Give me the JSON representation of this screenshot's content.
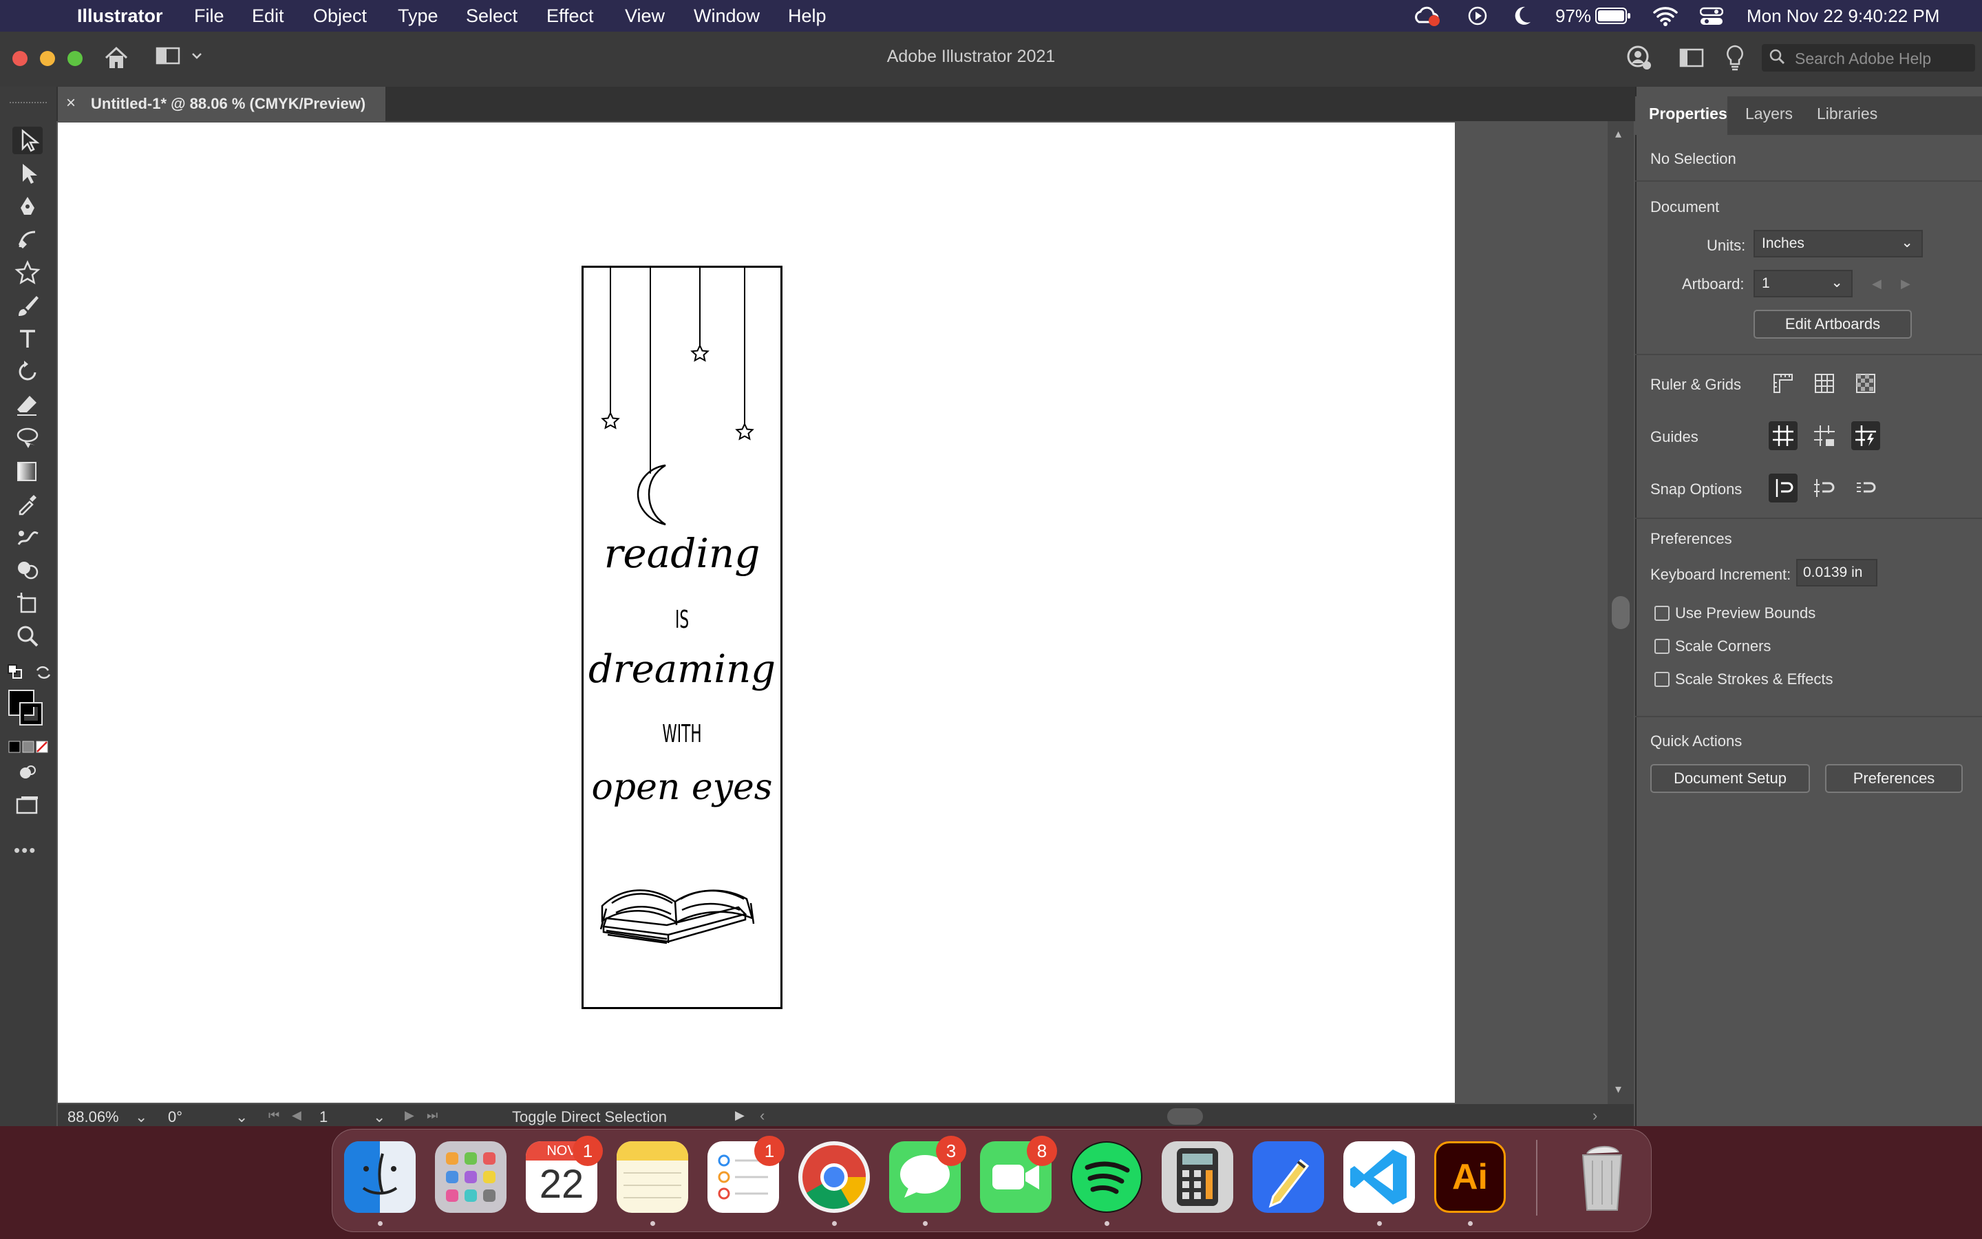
{
  "menubar": {
    "app_name": "Illustrator",
    "items": [
      "File",
      "Edit",
      "Object",
      "Type",
      "Select",
      "Effect",
      "View",
      "Window",
      "Help"
    ],
    "battery": "97%",
    "datetime": "Mon Nov 22  9:40:22 PM"
  },
  "window": {
    "title": "Adobe Illustrator 2021",
    "search_placeholder": "Search Adobe Help"
  },
  "document_tab": {
    "title": "Untitled-1* @ 88.06 % (CMYK/Preview)",
    "close": "×"
  },
  "artwork": {
    "word1": "reading",
    "word2": "IS",
    "word3": "dreaming",
    "word4": "WITH",
    "word5": "open eyes"
  },
  "statusbar": {
    "zoom": "88.06%",
    "rotation": "0°",
    "artboard": "1",
    "tool_hint": "Toggle Direct Selection"
  },
  "panel": {
    "tabs": [
      "Properties",
      "Layers",
      "Libraries"
    ],
    "selection": "No Selection",
    "document_heading": "Document",
    "units_label": "Units:",
    "units_value": "Inches",
    "artboard_label": "Artboard:",
    "artboard_value": "1",
    "edit_artboards": "Edit Artboards",
    "ruler_grids": "Ruler & Grids",
    "guides": "Guides",
    "snap_options": "Snap Options",
    "preferences_heading": "Preferences",
    "keyboard_increment_label": "Keyboard Increment:",
    "keyboard_increment_value": "0.0139 in",
    "checkboxes": [
      "Use Preview Bounds",
      "Scale Corners",
      "Scale Strokes & Effects"
    ],
    "quick_actions": "Quick Actions",
    "document_setup": "Document Setup",
    "preferences_button": "Preferences"
  },
  "dock": {
    "calendar_month": "NOV",
    "calendar_day": "22",
    "badges": {
      "calendar": "1",
      "reminders": "1",
      "messages": "3",
      "facetime": "8"
    },
    "illustrator_label": "Ai"
  }
}
